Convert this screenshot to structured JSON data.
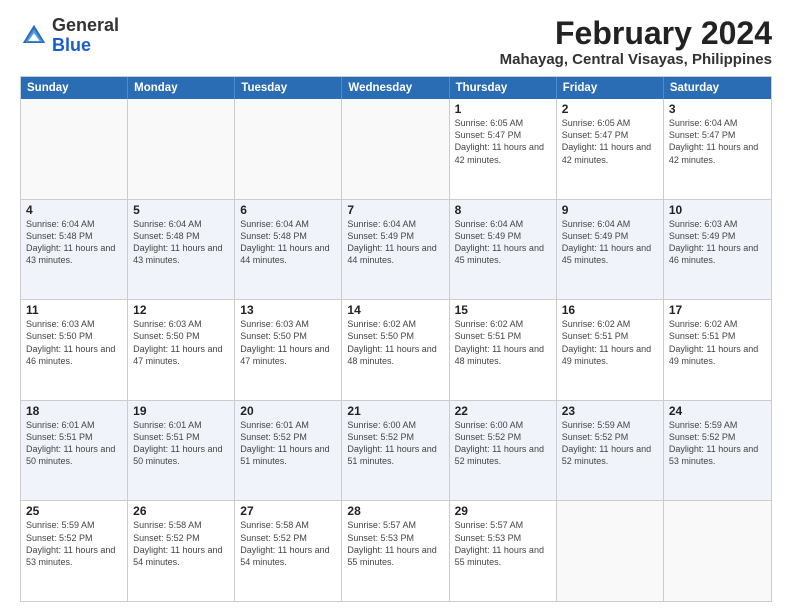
{
  "logo": {
    "general": "General",
    "blue": "Blue"
  },
  "title": "February 2024",
  "location": "Mahayag, Central Visayas, Philippines",
  "days": [
    "Sunday",
    "Monday",
    "Tuesday",
    "Wednesday",
    "Thursday",
    "Friday",
    "Saturday"
  ],
  "rows": [
    {
      "alt": false,
      "cells": [
        {
          "day": "",
          "text": ""
        },
        {
          "day": "",
          "text": ""
        },
        {
          "day": "",
          "text": ""
        },
        {
          "day": "",
          "text": ""
        },
        {
          "day": "1",
          "text": "Sunrise: 6:05 AM\nSunset: 5:47 PM\nDaylight: 11 hours and 42 minutes."
        },
        {
          "day": "2",
          "text": "Sunrise: 6:05 AM\nSunset: 5:47 PM\nDaylight: 11 hours and 42 minutes."
        },
        {
          "day": "3",
          "text": "Sunrise: 6:04 AM\nSunset: 5:47 PM\nDaylight: 11 hours and 42 minutes."
        }
      ]
    },
    {
      "alt": true,
      "cells": [
        {
          "day": "4",
          "text": "Sunrise: 6:04 AM\nSunset: 5:48 PM\nDaylight: 11 hours and 43 minutes."
        },
        {
          "day": "5",
          "text": "Sunrise: 6:04 AM\nSunset: 5:48 PM\nDaylight: 11 hours and 43 minutes."
        },
        {
          "day": "6",
          "text": "Sunrise: 6:04 AM\nSunset: 5:48 PM\nDaylight: 11 hours and 44 minutes."
        },
        {
          "day": "7",
          "text": "Sunrise: 6:04 AM\nSunset: 5:49 PM\nDaylight: 11 hours and 44 minutes."
        },
        {
          "day": "8",
          "text": "Sunrise: 6:04 AM\nSunset: 5:49 PM\nDaylight: 11 hours and 45 minutes."
        },
        {
          "day": "9",
          "text": "Sunrise: 6:04 AM\nSunset: 5:49 PM\nDaylight: 11 hours and 45 minutes."
        },
        {
          "day": "10",
          "text": "Sunrise: 6:03 AM\nSunset: 5:49 PM\nDaylight: 11 hours and 46 minutes."
        }
      ]
    },
    {
      "alt": false,
      "cells": [
        {
          "day": "11",
          "text": "Sunrise: 6:03 AM\nSunset: 5:50 PM\nDaylight: 11 hours and 46 minutes."
        },
        {
          "day": "12",
          "text": "Sunrise: 6:03 AM\nSunset: 5:50 PM\nDaylight: 11 hours and 47 minutes."
        },
        {
          "day": "13",
          "text": "Sunrise: 6:03 AM\nSunset: 5:50 PM\nDaylight: 11 hours and 47 minutes."
        },
        {
          "day": "14",
          "text": "Sunrise: 6:02 AM\nSunset: 5:50 PM\nDaylight: 11 hours and 48 minutes."
        },
        {
          "day": "15",
          "text": "Sunrise: 6:02 AM\nSunset: 5:51 PM\nDaylight: 11 hours and 48 minutes."
        },
        {
          "day": "16",
          "text": "Sunrise: 6:02 AM\nSunset: 5:51 PM\nDaylight: 11 hours and 49 minutes."
        },
        {
          "day": "17",
          "text": "Sunrise: 6:02 AM\nSunset: 5:51 PM\nDaylight: 11 hours and 49 minutes."
        }
      ]
    },
    {
      "alt": true,
      "cells": [
        {
          "day": "18",
          "text": "Sunrise: 6:01 AM\nSunset: 5:51 PM\nDaylight: 11 hours and 50 minutes."
        },
        {
          "day": "19",
          "text": "Sunrise: 6:01 AM\nSunset: 5:51 PM\nDaylight: 11 hours and 50 minutes."
        },
        {
          "day": "20",
          "text": "Sunrise: 6:01 AM\nSunset: 5:52 PM\nDaylight: 11 hours and 51 minutes."
        },
        {
          "day": "21",
          "text": "Sunrise: 6:00 AM\nSunset: 5:52 PM\nDaylight: 11 hours and 51 minutes."
        },
        {
          "day": "22",
          "text": "Sunrise: 6:00 AM\nSunset: 5:52 PM\nDaylight: 11 hours and 52 minutes."
        },
        {
          "day": "23",
          "text": "Sunrise: 5:59 AM\nSunset: 5:52 PM\nDaylight: 11 hours and 52 minutes."
        },
        {
          "day": "24",
          "text": "Sunrise: 5:59 AM\nSunset: 5:52 PM\nDaylight: 11 hours and 53 minutes."
        }
      ]
    },
    {
      "alt": false,
      "cells": [
        {
          "day": "25",
          "text": "Sunrise: 5:59 AM\nSunset: 5:52 PM\nDaylight: 11 hours and 53 minutes."
        },
        {
          "day": "26",
          "text": "Sunrise: 5:58 AM\nSunset: 5:52 PM\nDaylight: 11 hours and 54 minutes."
        },
        {
          "day": "27",
          "text": "Sunrise: 5:58 AM\nSunset: 5:52 PM\nDaylight: 11 hours and 54 minutes."
        },
        {
          "day": "28",
          "text": "Sunrise: 5:57 AM\nSunset: 5:53 PM\nDaylight: 11 hours and 55 minutes."
        },
        {
          "day": "29",
          "text": "Sunrise: 5:57 AM\nSunset: 5:53 PM\nDaylight: 11 hours and 55 minutes."
        },
        {
          "day": "",
          "text": ""
        },
        {
          "day": "",
          "text": ""
        }
      ]
    }
  ]
}
